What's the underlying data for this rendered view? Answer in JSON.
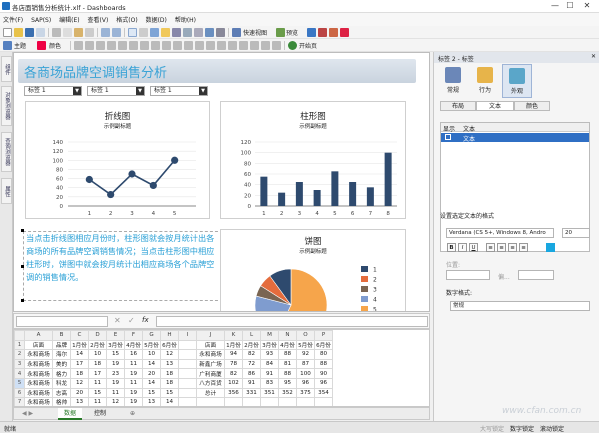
{
  "window": {
    "title": "各店面销售分析统计.xlf - Dashboards",
    "minimize": "—",
    "maximize": "☐",
    "close": "✕"
  },
  "menu": [
    "文件(F)",
    "SAP(S)",
    "编辑(E)",
    "查看(V)",
    "格式(O)",
    "数据(D)",
    "帮助(H)"
  ],
  "toolbar": {
    "main_label": "主题",
    "color_label": "颜色",
    "quickview_label": "快速视图",
    "preview_label": "预览",
    "start_label": "开始页"
  },
  "left_tabs": [
    "组件",
    "对象浏览器",
    "查询浏览器",
    "属性"
  ],
  "dashboard": {
    "title": "各商场品牌空调销售分析",
    "combos": [
      "标签 1",
      "标签 1",
      "标签 1"
    ],
    "line_panel": {
      "title": "折线图",
      "subtitle": "示例副标题"
    },
    "bar_panel": {
      "title": "柱形图",
      "subtitle": "示例副标题"
    },
    "pie_panel": {
      "title": "饼图",
      "subtitle": "示例副标题"
    },
    "textbox": "当点击折线图相应月份时，柱形图就会按月统计出各商场的所有品牌空调销售情况；当点击柱形图中相应柱形时，饼图中就会按月统计出相应商场各个品牌空调的销售情况。"
  },
  "chart_data": [
    {
      "type": "line",
      "x": [
        "1",
        "2",
        "3",
        "4",
        "5"
      ],
      "values": [
        58,
        25,
        70,
        45,
        100
      ],
      "ylim": [
        0,
        140
      ],
      "yticks": [
        "0",
        "20",
        "40",
        "60",
        "80",
        "100",
        "120",
        "140"
      ]
    },
    {
      "type": "bar",
      "x": [
        "1",
        "2",
        "3",
        "4",
        "5",
        "6",
        "7",
        "8"
      ],
      "values": [
        55,
        25,
        45,
        30,
        65,
        45,
        35,
        100
      ],
      "ylim": [
        0,
        120
      ],
      "yticks": [
        "0",
        "20",
        "40",
        "60",
        "80",
        "100",
        "120"
      ]
    },
    {
      "type": "pie",
      "legend": [
        "1",
        "2",
        "3",
        "4",
        "5"
      ],
      "colors": [
        "#2e4a6e",
        "#e46c3d",
        "#7a6552",
        "#7f9ccf",
        "#f6a54b"
      ],
      "values": [
        10,
        6,
        5,
        22,
        57
      ]
    }
  ],
  "formula": {
    "cellref": "",
    "fx": "fx"
  },
  "sheet": {
    "col_headers": [
      "",
      "A",
      "B",
      "C",
      "D",
      "E",
      "F",
      "G",
      "H",
      "I",
      "J",
      "K",
      "L",
      "M",
      "N",
      "O",
      "P"
    ],
    "rows": [
      [
        "1",
        "店面",
        "品牌",
        "1月份",
        "2月份",
        "3月份",
        "4月份",
        "5月份",
        "6月份",
        "",
        "店面",
        "1月份",
        "2月份",
        "3月份",
        "4月份",
        "5月份",
        "6月份"
      ],
      [
        "2",
        "永和商场",
        "海尔",
        "14",
        "10",
        "15",
        "16",
        "10",
        "12",
        "",
        "永和商场",
        "94",
        "82",
        "93",
        "88",
        "92",
        "80"
      ],
      [
        "3",
        "永和商场",
        "美的",
        "17",
        "18",
        "19",
        "11",
        "14",
        "13",
        "",
        "新鑫广场",
        "78",
        "72",
        "84",
        "81",
        "87",
        "88"
      ],
      [
        "4",
        "永和商场",
        "格力",
        "18",
        "17",
        "23",
        "19",
        "20",
        "18",
        "",
        "广利商厦",
        "82",
        "86",
        "91",
        "88",
        "100",
        "90"
      ],
      [
        "5",
        "永和商场",
        "科龙",
        "12",
        "11",
        "19",
        "11",
        "14",
        "18",
        "",
        "八方百货",
        "102",
        "91",
        "83",
        "95",
        "96",
        "96"
      ],
      [
        "6",
        "永和商场",
        "志高",
        "20",
        "15",
        "11",
        "19",
        "15",
        "15",
        "",
        "总计",
        "356",
        "331",
        "351",
        "352",
        "375",
        "354"
      ],
      [
        "7",
        "永和商场",
        "格帅",
        "13",
        "11",
        "12",
        "19",
        "13",
        "14",
        "",
        "",
        "",
        "",
        "",
        "",
        "",
        ""
      ]
    ],
    "tabs": [
      "数据",
      "控制"
    ]
  },
  "status": {
    "left": "就绪",
    "snap": "大写锁定",
    "num": "数字锁定",
    "scroll": "滚动锁定"
  },
  "props": {
    "header": "标签 2 - 标签",
    "big_buttons": [
      "常规",
      "行为",
      "外观"
    ],
    "tabs": [
      "布局",
      "文本",
      "颜色"
    ],
    "list_headers": [
      "显示",
      "文本"
    ],
    "list_row": "文本",
    "section_label": "设置选定文本的格式",
    "font_name": "Verdana (CS 5+, Windows 8, Andro",
    "font_size": "20",
    "position_label": "位置:",
    "offset_label": "偏...",
    "number_format_label": "数字格式:",
    "number_format_value": "常规",
    "watermark": "www.cfan.com.cn"
  }
}
